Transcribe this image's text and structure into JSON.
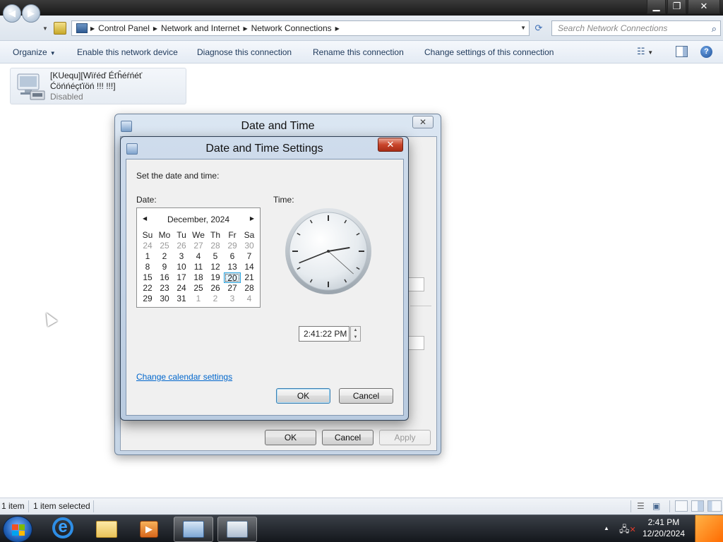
{
  "window": {
    "address": {
      "crumbs": [
        "Control Panel",
        "Network and Internet",
        "Network Connections"
      ]
    },
    "search_placeholder": "Search Network Connections"
  },
  "commandbar": {
    "organize": "Organize",
    "enable": "Enable this network device",
    "diagnose": "Diagnose this connection",
    "rename": "Rename this connection",
    "change": "Change settings of this connection"
  },
  "connection": {
    "name_line1": "[KUequ][Wïŕéď Éťĥéŕńéť",
    "name_line2": "Ćöńńéçťïöń !!! !!!]",
    "status": "Disabled"
  },
  "statusbar": {
    "count": "1 item",
    "selected": "1 item selected"
  },
  "dialog_outer": {
    "title": "Date and Time",
    "ok": "OK",
    "cancel": "Cancel",
    "apply": "Apply"
  },
  "dialog_inner": {
    "title": "Date and Time Settings",
    "prompt": "Set the date and time:",
    "date_label": "Date:",
    "time_label": "Time:",
    "calendar": {
      "month": "December, 2024",
      "weekdays": [
        "Su",
        "Mo",
        "Tu",
        "We",
        "Th",
        "Fr",
        "Sa"
      ],
      "days": [
        {
          "d": "24",
          "o": true
        },
        {
          "d": "25",
          "o": true
        },
        {
          "d": "26",
          "o": true
        },
        {
          "d": "27",
          "o": true
        },
        {
          "d": "28",
          "o": true
        },
        {
          "d": "29",
          "o": true
        },
        {
          "d": "30",
          "o": true
        },
        {
          "d": "1"
        },
        {
          "d": "2"
        },
        {
          "d": "3"
        },
        {
          "d": "4"
        },
        {
          "d": "5"
        },
        {
          "d": "6"
        },
        {
          "d": "7"
        },
        {
          "d": "8"
        },
        {
          "d": "9"
        },
        {
          "d": "10"
        },
        {
          "d": "11"
        },
        {
          "d": "12"
        },
        {
          "d": "13"
        },
        {
          "d": "14"
        },
        {
          "d": "15"
        },
        {
          "d": "16"
        },
        {
          "d": "17"
        },
        {
          "d": "18"
        },
        {
          "d": "19"
        },
        {
          "d": "20",
          "sel": true
        },
        {
          "d": "21"
        },
        {
          "d": "22"
        },
        {
          "d": "23"
        },
        {
          "d": "24"
        },
        {
          "d": "25"
        },
        {
          "d": "26"
        },
        {
          "d": "27"
        },
        {
          "d": "28"
        },
        {
          "d": "29"
        },
        {
          "d": "30"
        },
        {
          "d": "31"
        },
        {
          "d": "1",
          "o": true
        },
        {
          "d": "2",
          "o": true
        },
        {
          "d": "3",
          "o": true
        },
        {
          "d": "4",
          "o": true
        }
      ]
    },
    "time_value": "2:41:22 PM",
    "clock": {
      "hour": 2,
      "minute": 41,
      "second": 22
    },
    "change_calendar_link": "Change calendar settings",
    "ok": "OK",
    "cancel": "Cancel"
  },
  "taskbar": {
    "time": "2:41 PM",
    "date": "12/20/2024"
  }
}
